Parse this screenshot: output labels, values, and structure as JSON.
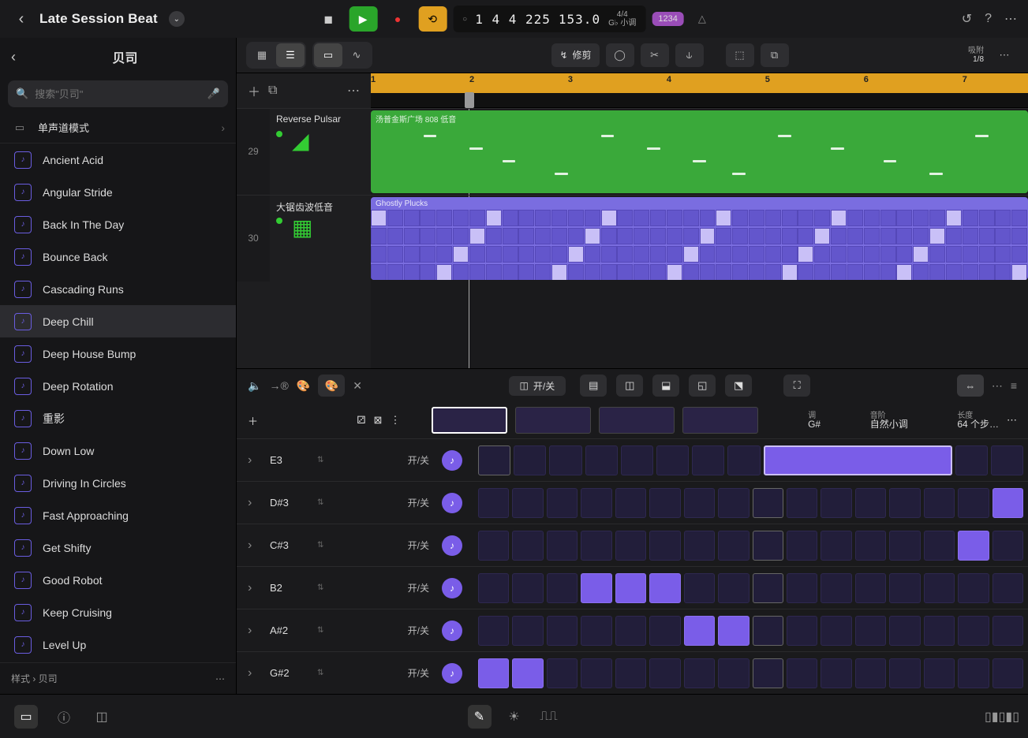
{
  "project": {
    "title": "Late Session Beat"
  },
  "transport": {
    "position": "1 4 4 225",
    "tempo": "153.0",
    "sig_top": "4/4",
    "sig_bot": "G♭ 小调",
    "countin": "1234"
  },
  "sidebar": {
    "back_title": "贝司",
    "search_placeholder": "搜索\"贝司\"",
    "category": "单声道模式",
    "presets": [
      "Ancient Acid",
      "Angular Stride",
      "Back In The Day",
      "Bounce Back",
      "Cascading Runs",
      "Deep Chill",
      "Deep House Bump",
      "Deep Rotation",
      "重影",
      "Down Low",
      "Driving In Circles",
      "Fast Approaching",
      "Get Shifty",
      "Good Robot",
      "Keep Cruising",
      "Level Up"
    ],
    "selected_index": 5,
    "breadcrumb": "样式 › 贝司"
  },
  "toolbar": {
    "function_label": "修剪",
    "snap_label": "吸附",
    "snap_value": "1/8"
  },
  "ruler": {
    "bars": [
      "1",
      "2",
      "3",
      "4",
      "5",
      "6",
      "7"
    ],
    "playhead_pct": 15
  },
  "tracks": [
    {
      "num": "29",
      "name": "Reverse Pulsar",
      "region_name": "汤普金斯广场 808 低音",
      "color": "green"
    },
    {
      "num": "30",
      "name": "大锯齿波低音",
      "region_name": "Ghostly Plucks",
      "color": "purple"
    }
  ],
  "step_panel": {
    "onoff_label": "开/关",
    "info": {
      "key_label": "调",
      "key": "G#",
      "scale_label": "音阶",
      "scale": "自然小调",
      "len_label": "长度",
      "len": "64 个步…"
    },
    "rows": [
      {
        "note": "E3",
        "cells": [
          0,
          0,
          0,
          0,
          0,
          0,
          0,
          0,
          0,
          0,
          0,
          0,
          0,
          0
        ],
        "big_span": [
          8,
          6
        ],
        "outline_first": true
      },
      {
        "note": "D#3",
        "cells": [
          0,
          0,
          0,
          0,
          0,
          0,
          0,
          0,
          2,
          0,
          0,
          0,
          0,
          0,
          0,
          1
        ]
      },
      {
        "note": "C#3",
        "cells": [
          0,
          0,
          0,
          0,
          0,
          0,
          0,
          0,
          2,
          0,
          0,
          0,
          0,
          0,
          1,
          0
        ]
      },
      {
        "note": "B2",
        "cells": [
          0,
          0,
          0,
          1,
          1,
          1,
          0,
          0,
          2,
          0,
          0,
          0,
          0,
          0,
          0,
          0
        ]
      },
      {
        "note": "A#2",
        "cells": [
          0,
          0,
          0,
          0,
          0,
          0,
          1,
          1,
          2,
          0,
          0,
          0,
          0,
          0,
          0,
          0
        ]
      },
      {
        "note": "G#2",
        "cells": [
          1,
          1,
          0,
          0,
          0,
          0,
          0,
          0,
          2,
          0,
          0,
          0,
          0,
          0,
          0,
          0
        ]
      }
    ]
  }
}
